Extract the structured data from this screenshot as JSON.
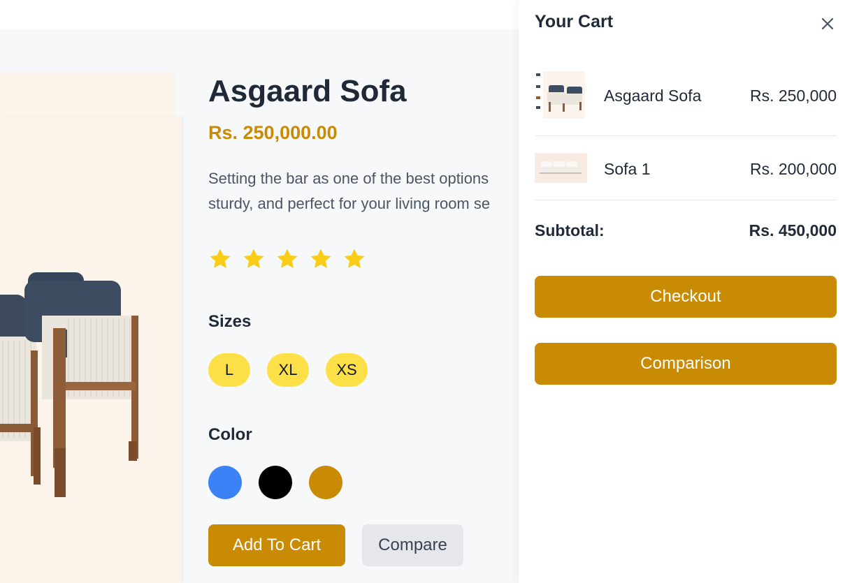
{
  "product": {
    "title": "Asgaard Sofa",
    "price": "Rs. 250,000.00",
    "description_line1": "Setting the bar as one of the best options",
    "description_line2": "sturdy, and perfect for your living room se",
    "rating": 5,
    "rating_max": 5,
    "sizes_label": "Sizes",
    "sizes": [
      "L",
      "XL",
      "XS"
    ],
    "color_label": "Color",
    "colors": [
      "#3b82f6",
      "#000000",
      "#c98a04"
    ],
    "add_to_cart_label": "Add To Cart",
    "compare_label": "Compare"
  },
  "cart": {
    "title": "Your Cart",
    "items": [
      {
        "name": "Asgaard Sofa",
        "price": "Rs. 250,000"
      },
      {
        "name": "Sofa 1",
        "price": "Rs. 200,000"
      }
    ],
    "subtotal_label": "Subtotal:",
    "subtotal_value": "Rs. 450,000",
    "checkout_label": "Checkout",
    "comparison_label": "Comparison"
  },
  "colors": {
    "accent": "#c98a04",
    "star": "#facc15",
    "size_chip": "#fde047",
    "panel_bg": "#fcf3ea"
  }
}
